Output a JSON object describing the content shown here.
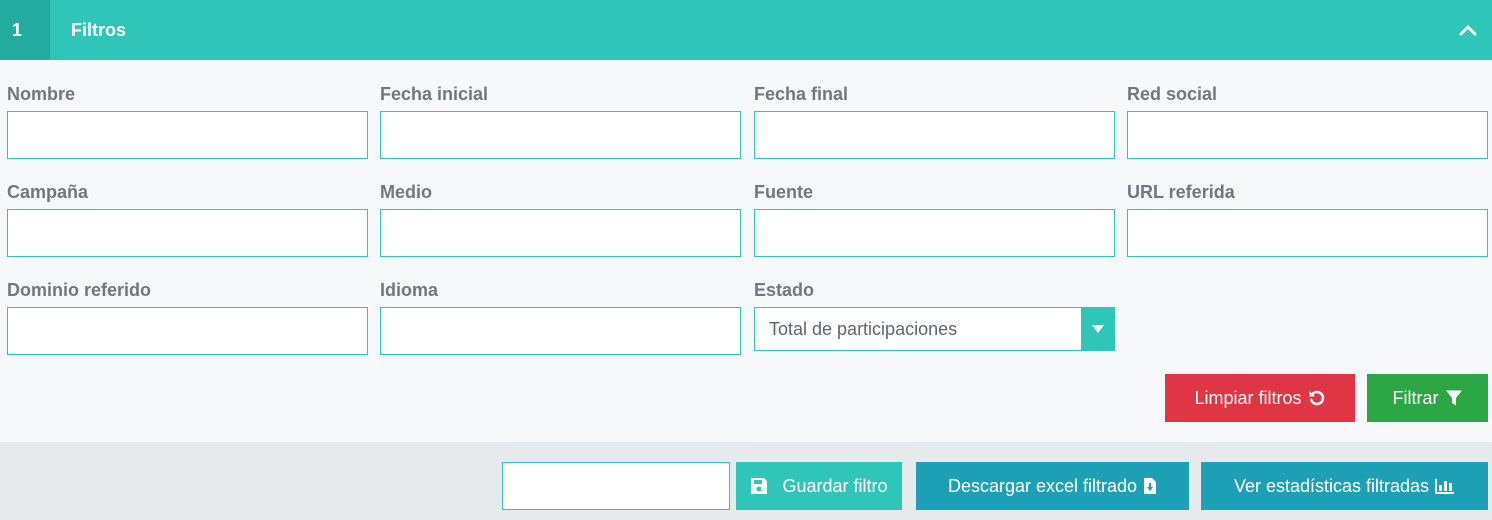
{
  "header": {
    "step": "1",
    "title": "Filtros"
  },
  "fields": {
    "nombre": {
      "label": "Nombre",
      "value": ""
    },
    "fecha_inicial": {
      "label": "Fecha inicial",
      "value": ""
    },
    "fecha_final": {
      "label": "Fecha final",
      "value": ""
    },
    "red_social": {
      "label": "Red social",
      "value": ""
    },
    "campana": {
      "label": "Campaña",
      "value": ""
    },
    "medio": {
      "label": "Medio",
      "value": ""
    },
    "fuente": {
      "label": "Fuente",
      "value": ""
    },
    "url_referida": {
      "label": "URL referida",
      "value": ""
    },
    "dominio_referido": {
      "label": "Dominio referido",
      "value": ""
    },
    "idioma": {
      "label": "Idioma",
      "value": ""
    },
    "estado": {
      "label": "Estado",
      "selected": "Total de participaciones"
    }
  },
  "actions": {
    "clear_label": "Limpiar filtros",
    "filter_label": "Filtrar"
  },
  "footer": {
    "save_input_value": "",
    "save_label": "Guardar filtro",
    "download_label": "Descargar excel filtrado",
    "stats_label": "Ver estadísticas filtradas"
  },
  "icons": {
    "collapse": "chevron-up-icon",
    "select_arrow": "caret-down-icon",
    "clear": "undo-icon",
    "filter": "filter-icon",
    "save": "floppy-disk-icon",
    "download": "file-download-icon",
    "stats": "bar-chart-icon"
  },
  "colors": {
    "accent": "#2fc6b9",
    "accent_dark": "#24ab9f",
    "danger": "#e03545",
    "success": "#2aa744",
    "info": "#1da0b5",
    "text": "#6f7881"
  }
}
